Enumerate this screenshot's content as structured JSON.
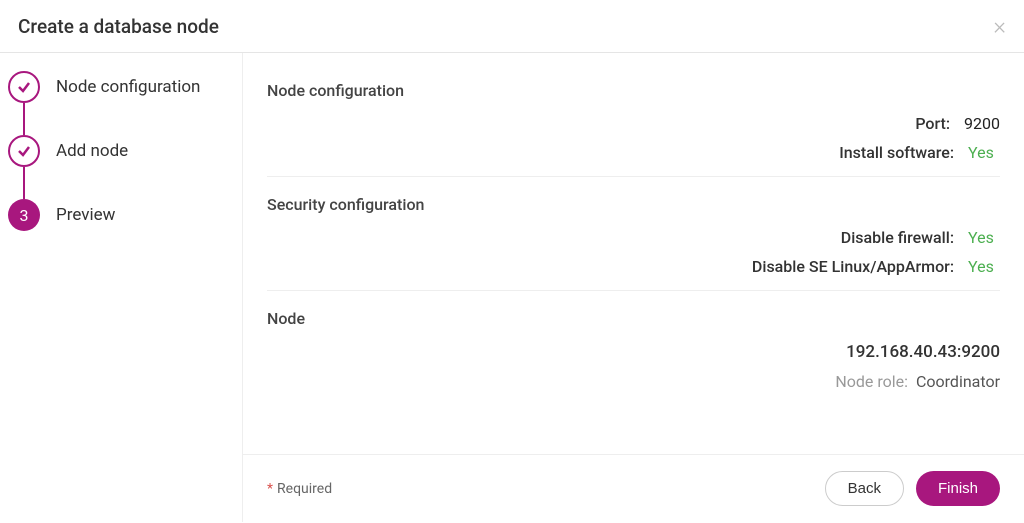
{
  "header": {
    "title": "Create a database node"
  },
  "steps": [
    {
      "label": "Node configuration",
      "state": "done"
    },
    {
      "label": "Add node",
      "state": "done"
    },
    {
      "label": "Preview",
      "state": "current",
      "number": "3"
    }
  ],
  "sections": {
    "node_config": {
      "title": "Node configuration",
      "port_label": "Port:",
      "port_value": "9200",
      "install_label": "Install software:",
      "install_value": "Yes"
    },
    "security": {
      "title": "Security configuration",
      "firewall_label": "Disable firewall:",
      "firewall_value": "Yes",
      "selinux_label": "Disable SE Linux/AppArmor:",
      "selinux_value": "Yes"
    },
    "node": {
      "title": "Node",
      "address": "192.168.40.43:9200",
      "role_label": "Node role:",
      "role_value": "Coordinator"
    }
  },
  "footer": {
    "required": "Required",
    "back": "Back",
    "finish": "Finish"
  }
}
